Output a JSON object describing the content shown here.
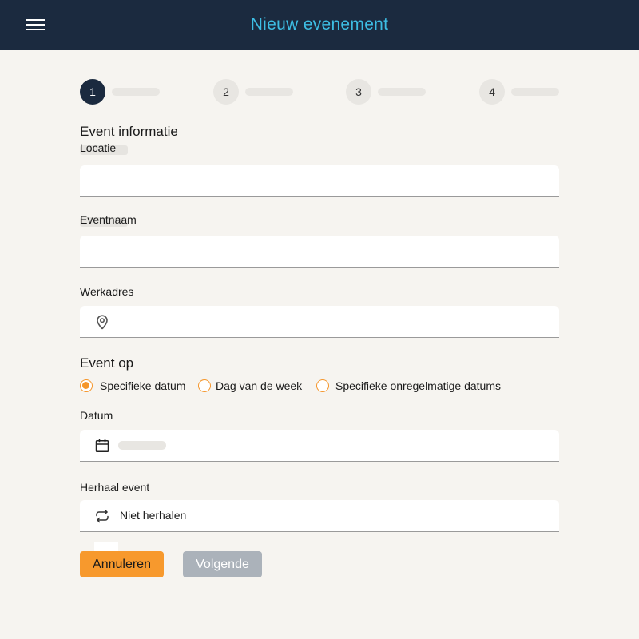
{
  "header": {
    "title": "Nieuw evenement",
    "menu_icon": "hamburger-menu-icon",
    "background": "#1b2a3f",
    "title_color": "#3dbde3"
  },
  "stepper": {
    "steps": [
      {
        "number": "1",
        "active": true
      },
      {
        "number": "2",
        "active": false
      },
      {
        "number": "3",
        "active": false
      },
      {
        "number": "4",
        "active": false
      }
    ]
  },
  "form": {
    "section_event_info": "Event informatie",
    "location": {
      "label": "Locatie",
      "value": ""
    },
    "event_name": {
      "label": "Eventnaam",
      "value": ""
    },
    "work_address": {
      "label": "Werkadres",
      "value": "",
      "icon": "map-pin-icon"
    },
    "event_on": {
      "label": "Event op",
      "options": [
        "Specifieke datum",
        "Dag van de week",
        "Specifieke onregelmatige datums"
      ],
      "selected": "Specifieke datum"
    },
    "date": {
      "label": "Datum",
      "value": "",
      "icon": "calendar-icon"
    },
    "repeat": {
      "label": "Herhaal event",
      "value": "Niet herhalen",
      "icon": "repeat-icon"
    }
  },
  "actions": {
    "cancel_label": "Annuleren",
    "next_label": "Volgende",
    "accent_color": "#f7992d",
    "disabled_color": "#abb2ba"
  }
}
